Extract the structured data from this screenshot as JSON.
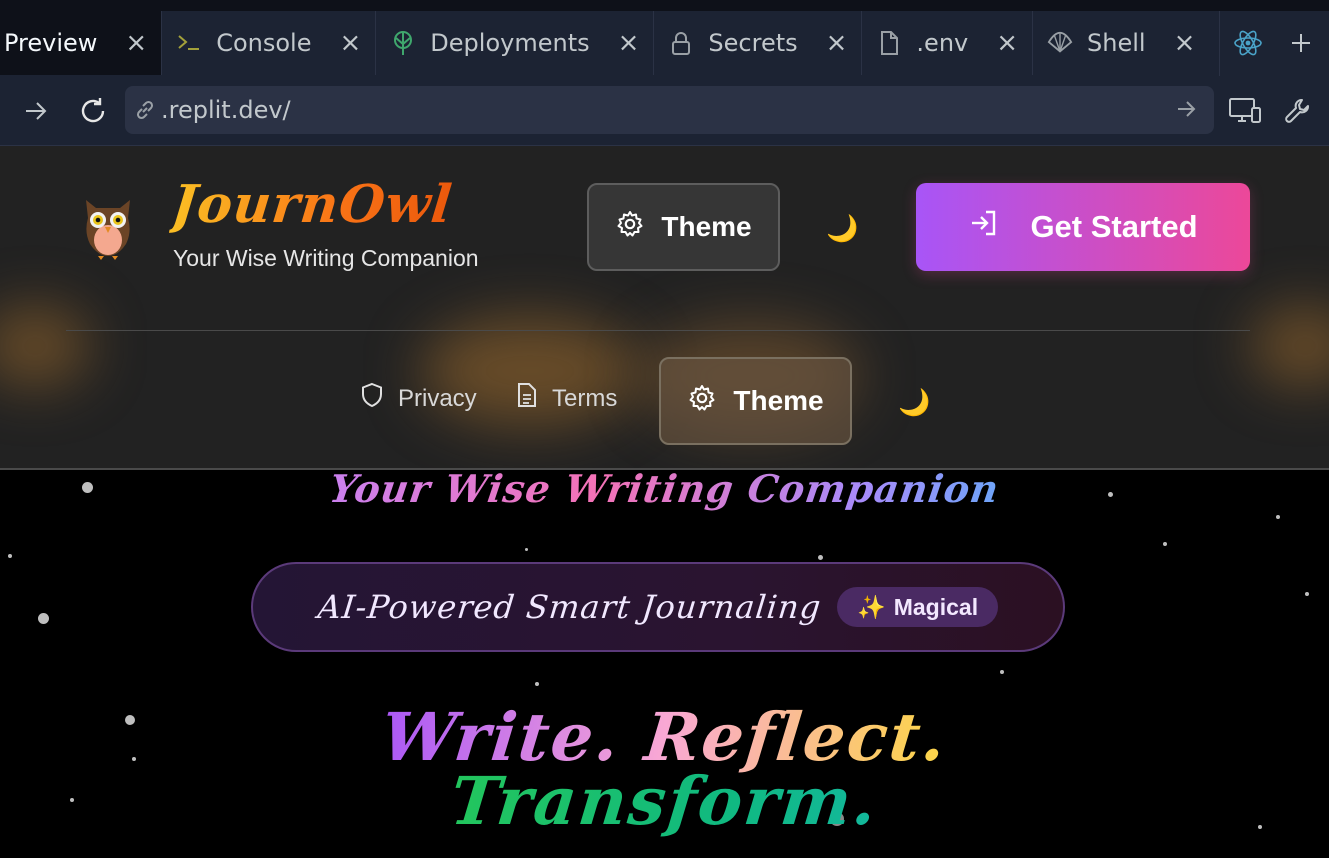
{
  "tabs": [
    {
      "label": "Preview",
      "icon": "preview-icon",
      "active": true
    },
    {
      "label": "Console",
      "icon": "console-icon"
    },
    {
      "label": "Deployments",
      "icon": "deployments-icon"
    },
    {
      "label": "Secrets",
      "icon": "lock-icon"
    },
    {
      "label": ".env",
      "icon": "file-icon"
    },
    {
      "label": "Shell",
      "icon": "shell-icon"
    }
  ],
  "address_bar": {
    "url": ".replit.dev/"
  },
  "app": {
    "brand_name": "JournOwl",
    "tagline": "Your Wise Writing Companion",
    "theme_label": "Theme",
    "moon_glyph": "🌙",
    "cta_label": "Get Started",
    "footer_links": {
      "privacy": "Privacy",
      "terms": "Terms",
      "theme": "Theme"
    }
  },
  "hero": {
    "subtitle": "Your Wise Writing Companion",
    "pill_text": "AI-Powered Smart Journaling",
    "badge_icon": "✨",
    "badge_text": "Magical",
    "headline_line1": "Write. Reflect.",
    "headline_line2": "Transform."
  },
  "colors": {
    "tab_bar": "#1c2333",
    "accent_gradient_start": "#a855f7",
    "accent_gradient_end": "#ec4899",
    "brand_orange": "#f97316"
  }
}
